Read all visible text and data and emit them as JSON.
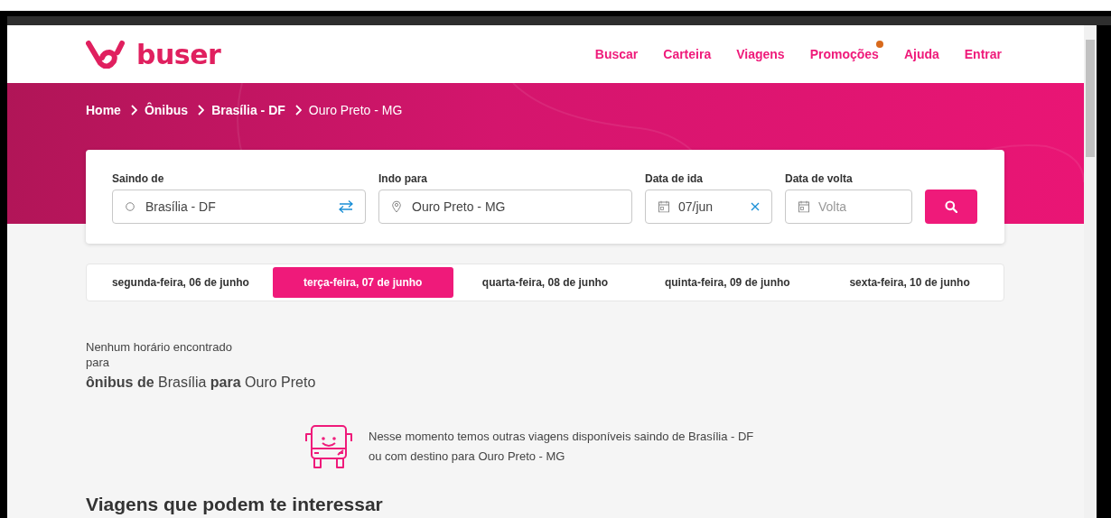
{
  "header": {
    "logo_text": "buser",
    "nav": [
      {
        "label": "Buscar",
        "badge": false
      },
      {
        "label": "Carteira",
        "badge": false
      },
      {
        "label": "Viagens",
        "badge": false
      },
      {
        "label": "Promoções",
        "badge": true
      },
      {
        "label": "Ajuda",
        "badge": false
      },
      {
        "label": "Entrar",
        "badge": false
      }
    ]
  },
  "breadcrumb": [
    {
      "label": "Home",
      "current": false
    },
    {
      "label": "Ônibus",
      "current": false
    },
    {
      "label": "Brasília - DF",
      "current": false
    },
    {
      "label": "Ouro Preto - MG",
      "current": true
    }
  ],
  "search": {
    "fields": [
      {
        "kind": "origin",
        "label": "Saindo de",
        "value": "Brasília - DF"
      },
      {
        "kind": "destination",
        "label": "Indo para",
        "value": "Ouro Preto - MG"
      },
      {
        "kind": "date",
        "label": "Data de ida",
        "value": "07/jun"
      },
      {
        "kind": "return",
        "label": "Data de volta",
        "placeholder": "Volta"
      }
    ]
  },
  "days": [
    {
      "label": "segunda-feira, 06 de junho",
      "selected": false
    },
    {
      "label": "terça-feira, 07 de junho",
      "selected": true
    },
    {
      "label": "quarta-feira, 08 de junho",
      "selected": false
    },
    {
      "label": "quinta-feira, 09 de junho",
      "selected": false
    },
    {
      "label": "sexta-feira, 10 de junho",
      "selected": false
    }
  ],
  "result": {
    "message": "Nenhum horário encontrado",
    "for": "para",
    "route": "**ônibus de** Brasília **para** Ouro Preto"
  },
  "notice": {
    "lines": [
      "Nesse momento temos outras viagens disponíveis saindo de Brasília - DF",
      "ou com destino para Ouro Preto - MG"
    ]
  },
  "section_title": "Viagens que podem te interessar"
}
